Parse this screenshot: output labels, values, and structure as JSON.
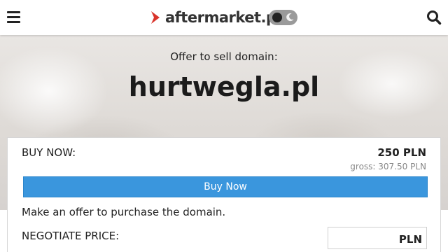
{
  "header": {
    "logo_text": "aftermarket.pl",
    "menu_icon": "hamburger-menu-icon",
    "search_icon": "search-icon",
    "theme_toggle": {
      "state": "dark-off",
      "icon": "moon-icon"
    },
    "accent_color": "#d9342b"
  },
  "hero": {
    "offer_label": "Offer to sell domain:",
    "domain": "hurtwegla.pl"
  },
  "buy": {
    "label": "BUY NOW:",
    "price": "250 PLN",
    "gross": "gross: 307.50 PLN",
    "button_label": "Buy Now",
    "button_color": "#3a96dd"
  },
  "offer": {
    "text": "Make an offer to purchase the domain.",
    "negotiate_label": "NEGOTIATE PRICE:",
    "price_value": "",
    "currency": "PLN"
  }
}
